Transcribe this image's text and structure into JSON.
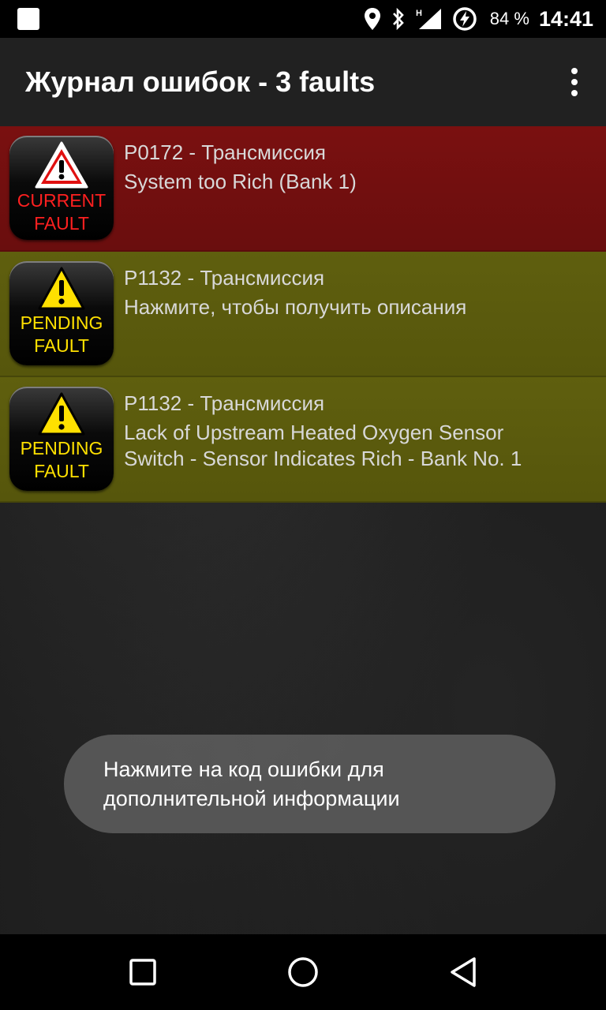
{
  "status_bar": {
    "battery_percent": "84 %",
    "time": "14:41",
    "icons": [
      "notification-icon",
      "location-icon",
      "bluetooth-icon",
      "signal-h-icon",
      "battery-charging-icon"
    ]
  },
  "app_bar": {
    "title": "Журнал ошибок - 3 faults",
    "menu_icon": "overflow-menu-icon"
  },
  "faults": [
    {
      "status": "current",
      "badge_line1": "CURRENT",
      "badge_line2": "FAULT",
      "badge_color": "#ff2020",
      "row_color": "#7a1010",
      "code": "P0172 - Трансмиссия",
      "description": "System too Rich (Bank 1)"
    },
    {
      "status": "pending",
      "badge_line1": "PENDING",
      "badge_line2": "FAULT",
      "badge_color": "#ffe000",
      "row_color": "#5f5f0e",
      "code": "P1132 - Трансмиссия",
      "description": "Нажмите, чтобы получить описания"
    },
    {
      "status": "pending",
      "badge_line1": "PENDING",
      "badge_line2": "FAULT",
      "badge_color": "#ffe000",
      "row_color": "#5f5f0e",
      "code": "P1132 - Трансмиссия",
      "description": "Lack of Upstream Heated Oxygen Sensor\nSwitch - Sensor Indicates Rich - Bank No. 1"
    }
  ],
  "toast": {
    "message": "Нажмите на код ошибки для\nдополнительной информации"
  },
  "nav_bar": {
    "icons": [
      "recents-square-icon",
      "home-circle-icon",
      "back-triangle-icon"
    ]
  }
}
